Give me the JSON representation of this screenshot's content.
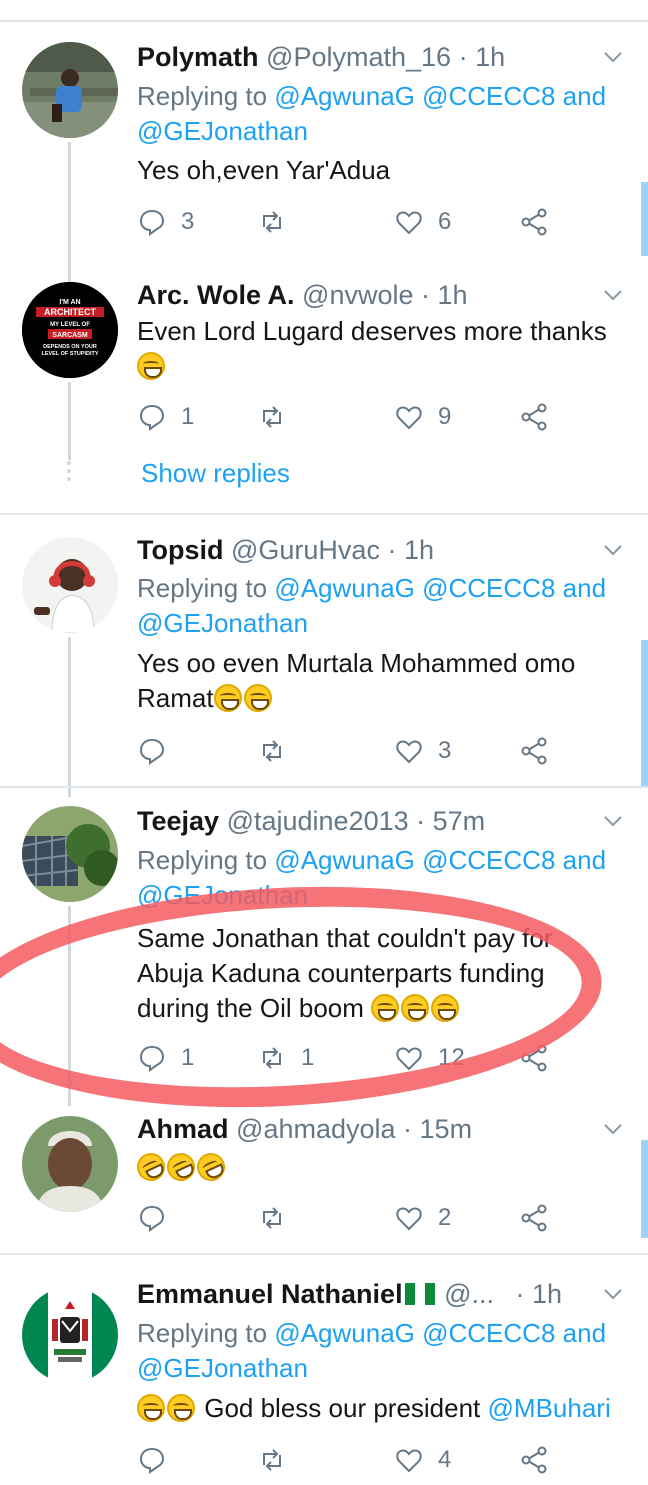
{
  "colors": {
    "accent": "#1da1f2",
    "secondary_text": "#657786",
    "annotation": "#f45a60"
  },
  "tweets": [
    {
      "name": "Polymath",
      "handle": "@Polymath_16",
      "time": "· 1h",
      "replying_label": "Replying to",
      "reply_targets": "@AgwunaG @CCECC8",
      "reply_and": "and",
      "reply_last": "@GEJonathan",
      "text": "Yes oh,even Yar'Adua",
      "replies": "3",
      "retweets": "",
      "likes": "6"
    },
    {
      "name": "Arc. Wole A.",
      "handle": "@nvwole",
      "time": "· 1h",
      "text": "Even Lord Lugard deserves more thanks",
      "avatar_text": [
        "I'M AN",
        "ARCHITECT",
        "MY LEVEL OF",
        "SARCASM",
        "DEPENDS ON YOUR",
        "LEVEL OF STUPIDITY"
      ],
      "replies": "1",
      "retweets": "",
      "likes": "9",
      "show_replies": "Show replies"
    },
    {
      "name": "Topsid",
      "handle": "@GuruHvac",
      "time": "· 1h",
      "replying_label": "Replying to",
      "reply_targets": "@AgwunaG @CCECC8",
      "reply_and": "and",
      "reply_last": "@GEJonathan",
      "text_line1": "Yes oo even Murtala Mohammed omo",
      "text_line2": "Ramat",
      "replies": "",
      "retweets": "",
      "likes": "3"
    },
    {
      "name": "Teejay",
      "handle": "@tajudine2013",
      "time": "· 57m",
      "replying_label": "Replying to",
      "reply_targets": "@AgwunaG @CCECC8",
      "reply_and": "and",
      "reply_last": "@GEJonathan",
      "text_line1": "Same Jonathan that couldn't pay for",
      "text_line2": "Abuja Kaduna counterparts funding",
      "text_line3": "during the Oil boom",
      "replies": "1",
      "retweets": "1",
      "likes": "12"
    },
    {
      "name": "Ahmad",
      "handle": "@ahmadyola",
      "time": "· 15m",
      "replies": "",
      "retweets": "",
      "likes": "2"
    },
    {
      "name": "Emmanuel Nathaniel",
      "handle": "@...",
      "time": "· 1h",
      "replying_label": "Replying to",
      "reply_targets": "@AgwunaG @CCECC8",
      "reply_and": "and",
      "reply_last": "@GEJonathan",
      "text": "God bless our president",
      "mention": "@MBuhari",
      "replies": "",
      "retweets": "",
      "likes": "4"
    }
  ]
}
